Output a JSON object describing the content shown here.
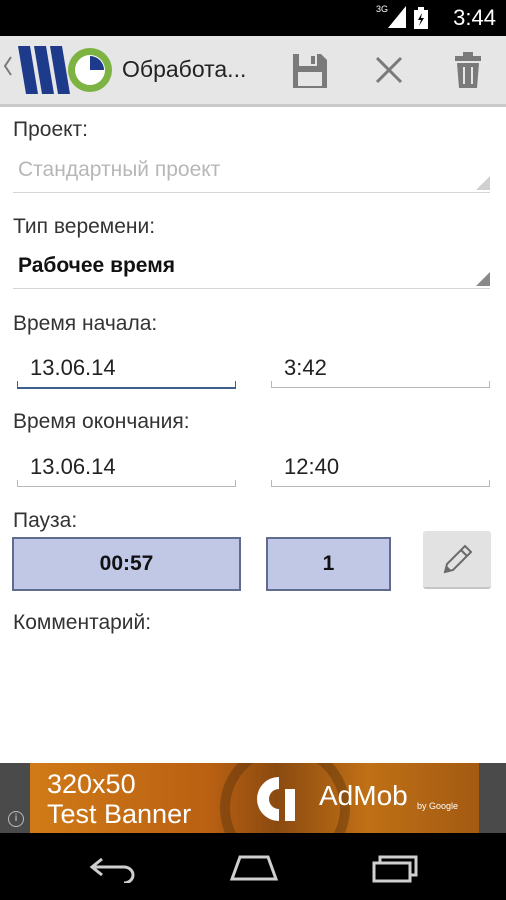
{
  "status_bar": {
    "network": "3G",
    "time": "3:44",
    "signal_icon": "signal-icon",
    "battery_icon": "battery-icon"
  },
  "action_bar": {
    "title": "Обработа...",
    "icons": [
      "up-chevron-icon",
      "app-logo",
      "save-icon",
      "discard-icon",
      "trash-icon"
    ],
    "logo_letter": "W"
  },
  "form": {
    "project": {
      "label": "Проект:",
      "value": "Стандартный проект",
      "enabled": false
    },
    "time_type": {
      "label": "Тип веремени:",
      "value": "Рабочее время"
    },
    "start": {
      "label": "Время начала:",
      "date": "13.06.14",
      "time": "3:42"
    },
    "end": {
      "label": "Время окончания:",
      "date": "13.06.14",
      "time": "12:40"
    },
    "pause": {
      "label": "Пауза:",
      "duration": "00:57",
      "count": "1",
      "edit_icon": "pencil-icon"
    },
    "comment": {
      "label": "Комментарий:",
      "value": ""
    }
  },
  "ad": {
    "line1": "320x50",
    "line2": "Test Banner",
    "brand": "AdMob",
    "by": "by Google",
    "info": "i"
  },
  "nav_bar": {
    "icons": [
      "back-icon",
      "home-icon",
      "recents-icon"
    ]
  },
  "colors": {
    "action_bar_bg": "#e6e6e6",
    "pause_box_bg": "#c0c8e6",
    "pause_box_border": "#5f6c8f",
    "focus_underline": "#3d5f8e",
    "logo_blue": "#1e3a8a",
    "logo_green": "#7cb342"
  }
}
